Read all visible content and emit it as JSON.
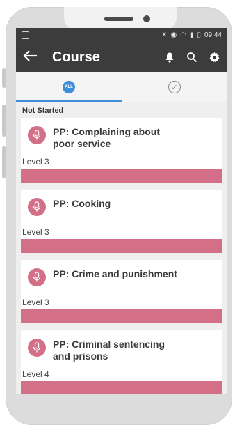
{
  "status_bar": {
    "time": "09:44"
  },
  "app_bar": {
    "title": "Course",
    "back_icon": "arrow-left-icon",
    "icons": [
      "bell-icon",
      "search-icon",
      "gear-icon"
    ]
  },
  "tabs": [
    {
      "label": "ALL",
      "icon": "all-badge-icon",
      "active": true
    },
    {
      "label": "",
      "icon": "check-circle-icon",
      "active": false
    }
  ],
  "section": {
    "title": "Not Started"
  },
  "courses": [
    {
      "title_line1": "PP: Complaining about",
      "title_line2": "poor service",
      "level": "Level 3"
    },
    {
      "title_line1": "PP: Cooking",
      "title_line2": "",
      "level": "Level 3"
    },
    {
      "title_line1": "PP: Crime and punishment",
      "title_line2": "",
      "level": "Level 3"
    },
    {
      "title_line1": "PP: Criminal sentencing",
      "title_line2": "and prisons",
      "level": "Level 4"
    }
  ],
  "colors": {
    "accent": "#d36f86",
    "appbar": "#3c3c3c",
    "tab_active": "#3f8edc"
  }
}
